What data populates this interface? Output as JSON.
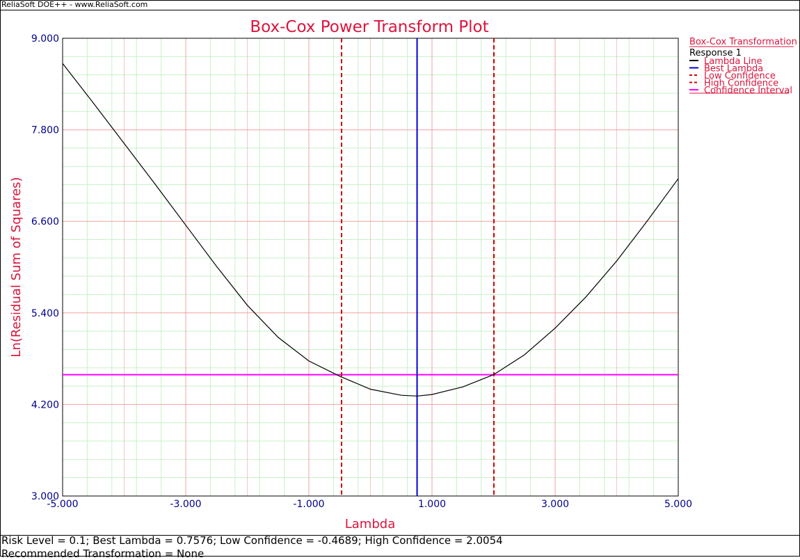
{
  "window": {
    "caption": "ReliaSoft DOE++ - www.ReliaSoft.com"
  },
  "colors": {
    "title": "#dc143c",
    "tick_label": "#00008b",
    "curve": "#000000",
    "best_lambda": "#0000cd",
    "confidence": "#cc0000",
    "confidence_interval": "#ff00ff",
    "major_grid": "#f0a0a0",
    "minor_grid": "#c8f0c8"
  },
  "chart_data": {
    "type": "line",
    "title": "Box-Cox Power Transform Plot",
    "xlabel": "Lambda",
    "ylabel": "Ln(Residual Sum of Squares)",
    "xlim": [
      -5,
      5
    ],
    "ylim": [
      3,
      9
    ],
    "x_ticks": [
      -5,
      -3,
      -1,
      1,
      3,
      5
    ],
    "x_tick_labels": [
      "-5.000",
      "-3.000",
      "-1.000",
      "1.000",
      "3.000",
      "5.000"
    ],
    "y_ticks": [
      3,
      4.2,
      5.4,
      6.6,
      7.8,
      9
    ],
    "y_tick_labels": [
      "3.000",
      "4.200",
      "5.400",
      "6.600",
      "7.800",
      "9.000"
    ],
    "grid": true,
    "legend_position": "right",
    "legend": {
      "group_title": "Box-Cox Transformation",
      "subtitle": "Response 1",
      "entries": [
        {
          "name": "Lambda Line",
          "style": "solid",
          "color": "#000000"
        },
        {
          "name": "Best Lambda",
          "style": "solid",
          "color": "#0000cd"
        },
        {
          "name": "Low Confidence",
          "style": "dashed",
          "color": "#cc0000"
        },
        {
          "name": "High Confidence",
          "style": "dashed",
          "color": "#cc0000"
        },
        {
          "name": "Confidence Interval",
          "style": "solid",
          "color": "#ff00ff"
        }
      ]
    },
    "series": [
      {
        "name": "Lambda Line",
        "x": [
          -5.0,
          -4.5,
          -4.0,
          -3.5,
          -3.0,
          -2.5,
          -2.0,
          -1.5,
          -1.0,
          -0.5,
          0.0,
          0.5,
          0.76,
          1.0,
          1.5,
          2.0,
          2.5,
          3.0,
          3.5,
          4.0,
          4.5,
          5.0
        ],
        "y": [
          8.67,
          8.15,
          7.62,
          7.09,
          6.55,
          6.01,
          5.5,
          5.08,
          4.77,
          4.57,
          4.4,
          4.32,
          4.31,
          4.33,
          4.43,
          4.59,
          4.85,
          5.2,
          5.61,
          6.08,
          6.61,
          7.16
        ]
      }
    ],
    "best_lambda": 0.7576,
    "low_confidence": -0.4689,
    "high_confidence": 2.0054,
    "confidence_interval_y": 4.59
  },
  "footer": {
    "line1": "Risk Level = 0.1; Best Lambda = 0.7576; Low Confidence = -0.4689; High Confidence = 2.0054",
    "line2": "Recommended Transformation = None"
  }
}
